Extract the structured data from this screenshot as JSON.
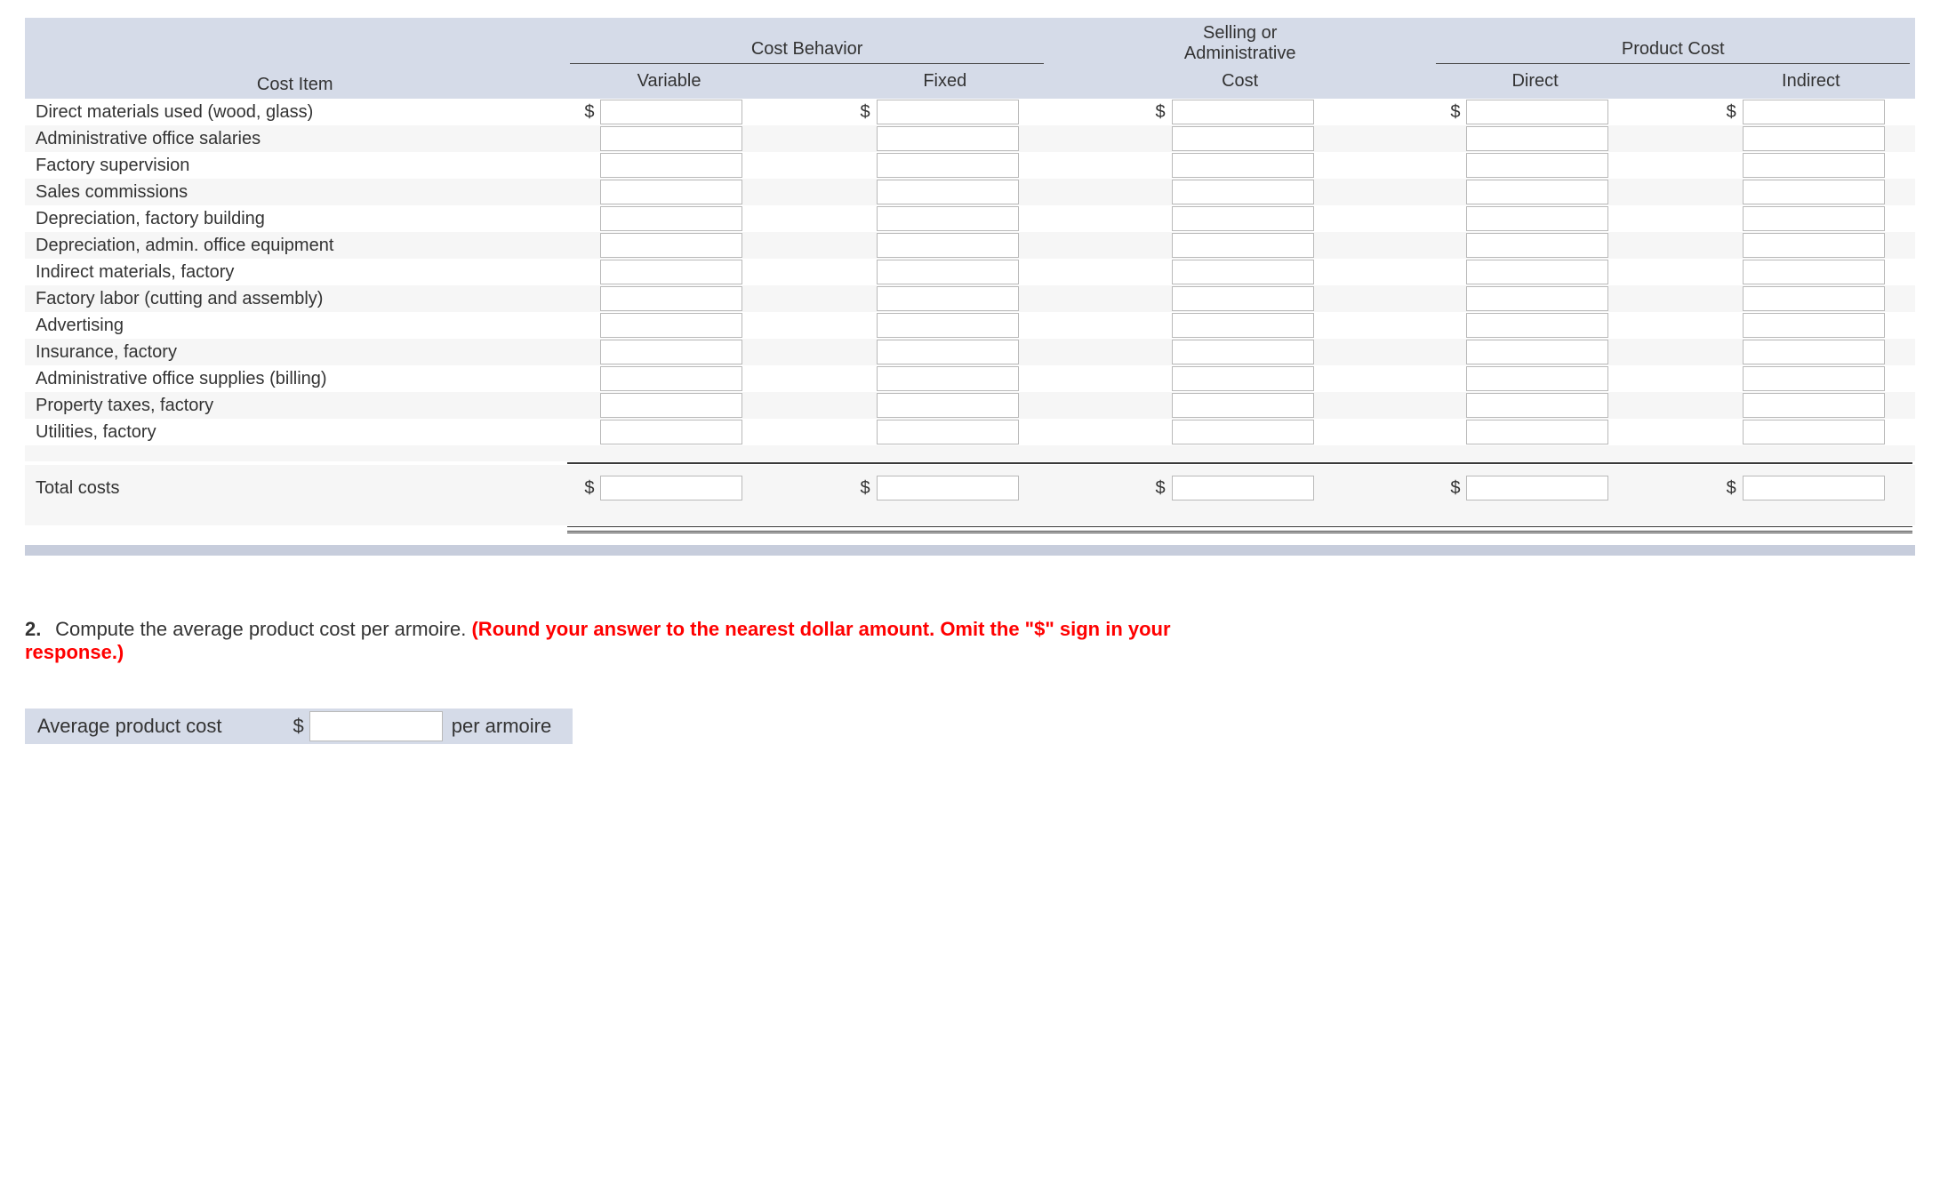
{
  "table": {
    "header": {
      "cost_item": "Cost Item",
      "group_behavior": "Cost Behavior",
      "group_selling": "Selling or Administrative Cost",
      "group_selling_line1": "Selling or",
      "group_selling_line2": "Administrative",
      "group_product": "Product Cost",
      "variable": "Variable",
      "fixed": "Fixed",
      "cost": "Cost",
      "direct": "Direct",
      "indirect": "Indirect"
    },
    "rows": [
      {
        "label": "Direct materials used (wood, glass)",
        "show_dollar": true
      },
      {
        "label": "Administrative office salaries",
        "show_dollar": false
      },
      {
        "label": "Factory supervision",
        "show_dollar": false
      },
      {
        "label": "Sales commissions",
        "show_dollar": false
      },
      {
        "label": "Depreciation, factory building",
        "show_dollar": false
      },
      {
        "label": "Depreciation, admin. office equipment",
        "show_dollar": false
      },
      {
        "label": "Indirect materials, factory",
        "show_dollar": false
      },
      {
        "label": "Factory labor (cutting and assembly)",
        "show_dollar": false
      },
      {
        "label": "Advertising",
        "show_dollar": false
      },
      {
        "label": "Insurance, factory",
        "show_dollar": false
      },
      {
        "label": "Administrative office supplies (billing)",
        "show_dollar": false
      },
      {
        "label": "Property taxes, factory",
        "show_dollar": false
      },
      {
        "label": "Utilities, factory",
        "show_dollar": false
      }
    ],
    "total_label": "Total costs",
    "currency": "$"
  },
  "q2": {
    "number": "2.",
    "text_main": "Compute the average product cost per armoire. ",
    "text_red": "(Round your answer to the nearest dollar amount. Omit the \"$\" sign in your response.)",
    "apc_label": "Average product cost",
    "apc_unit": "per armoire",
    "currency": "$"
  }
}
